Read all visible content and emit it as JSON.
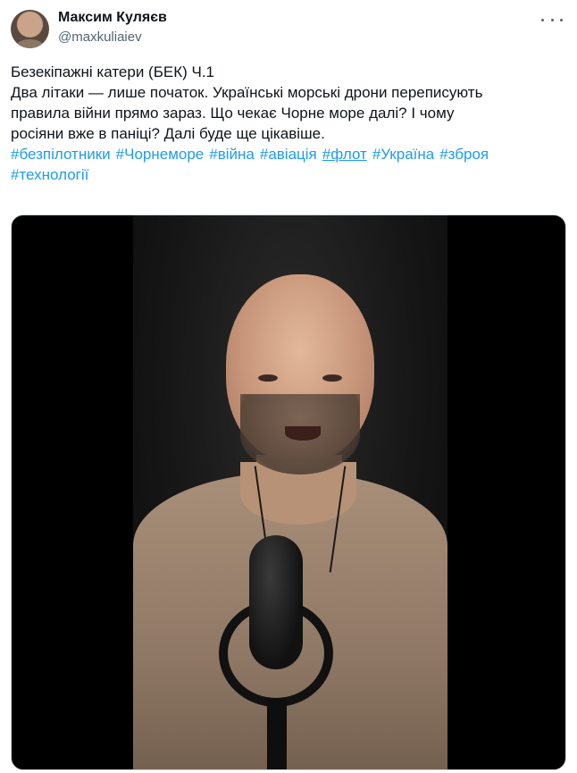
{
  "author": {
    "display_name": "Максим Куляєв",
    "handle": "@maxkuliaiev"
  },
  "tweet": {
    "lines": [
      "Безекіпажні катери (БЕК) Ч.1",
      "Два літаки — лише початок. Українські морські дрони переписують",
      "правила війни прямо зараз. Що чекає Чорне море далі? І чому",
      "росіяни вже в паніці? Далі буде ще цікавіше."
    ],
    "hashtags_line1": [
      "#безпілотники",
      "#Чорнеморе",
      "#війна",
      "#авіація",
      "#флот",
      "#Україна",
      "#зброя"
    ],
    "hashtags_line2": [
      "#технології"
    ]
  },
  "icons": {
    "more": "more-dots-icon",
    "avatar": "avatar-photo",
    "media": "video-thumbnail"
  }
}
